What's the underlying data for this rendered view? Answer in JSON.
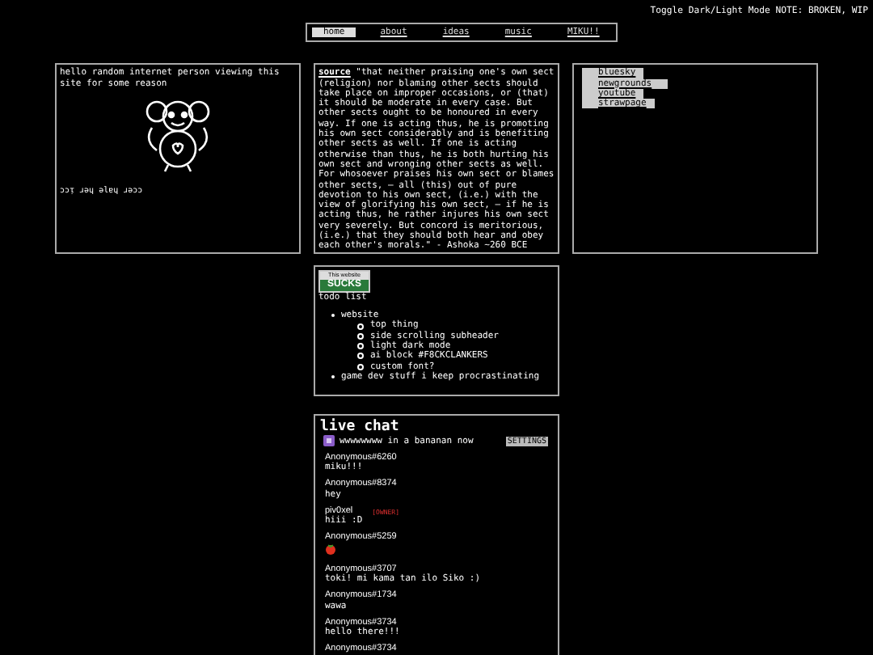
{
  "toggle_text": "Toggle Dark/Light Mode NOTE: BROKEN, WIP",
  "nav": [
    {
      "label": "home",
      "selected": true
    },
    {
      "label": "about",
      "selected": false
    },
    {
      "label": "ideas",
      "selected": false
    },
    {
      "label": "music",
      "selected": false
    },
    {
      "label": "MIKU!!",
      "selected": false
    }
  ],
  "intro": {
    "text": "hello random internet person viewing this site for some reason",
    "flipped_text": "ɔɔᴉ ɹǝɥ ǝlɐɥ ɹǝɔɔ"
  },
  "quote": {
    "source": "source",
    "text": "\"that neither praising one's own sect (religion) nor blaming other sects should take place on improper occasions, or (that) it should be moderate in every case. But other sects ought to be honoured in every way. If one is acting thus, he is promoting his own sect considerably and is benefiting other sects as well. If one is acting otherwise than thus, he is both hurting his own sect and wronging other sects as well. For whosoever praises his own sect or blames other sects, — all (this) out of pure devotion to his own sect, (i.e.) with the view of glorifying his own sect, — if he is acting thus, he rather injures his own sect very severely. But concord is meritorious, (i.e.) that they should both hear and obey each other's morals.\" - Ashoka ~260 BCE"
  },
  "links": [
    "bluesky",
    "newgrounds",
    "youtube",
    "strawpage"
  ],
  "badge": {
    "top": "This website",
    "bottom": "SUCKS"
  },
  "todo": {
    "title": "todo list",
    "items": [
      {
        "text": "website",
        "children": [
          {
            "text": "top thing"
          },
          {
            "text": "side scrolling subheader"
          },
          {
            "text": "light dark mode"
          },
          {
            "text": "ai block #F8CKCLANKERS"
          },
          {
            "text": "custom font?"
          }
        ]
      },
      {
        "text": "game dev stuff i keep procrastinating"
      }
    ]
  },
  "chat": {
    "title": "live chat",
    "status": "wwwwwwww in a bananan now",
    "settings": "SETTINGS",
    "messages": [
      {
        "name": "Anonymous#6260",
        "kind": "text",
        "text": "miku!!!"
      },
      {
        "name": "Anonymous#8374",
        "kind": "text",
        "text": "hey"
      },
      {
        "name": "piv0xel",
        "tag": "[OWNER]",
        "kind": "text",
        "text": "hiii :D"
      },
      {
        "name": "Anonymous#5259",
        "kind": "emoji"
      },
      {
        "name": "Anonymous#3707",
        "kind": "text",
        "text": "toki! mi kama tan ilo Siko :)"
      },
      {
        "name": "Anonymous#1734",
        "kind": "text",
        "text": "wawa"
      },
      {
        "name": "Anonymous#3734",
        "kind": "text",
        "text": "hello there!!!"
      },
      {
        "name": "Anonymous#3734",
        "kind": "none"
      }
    ]
  }
}
